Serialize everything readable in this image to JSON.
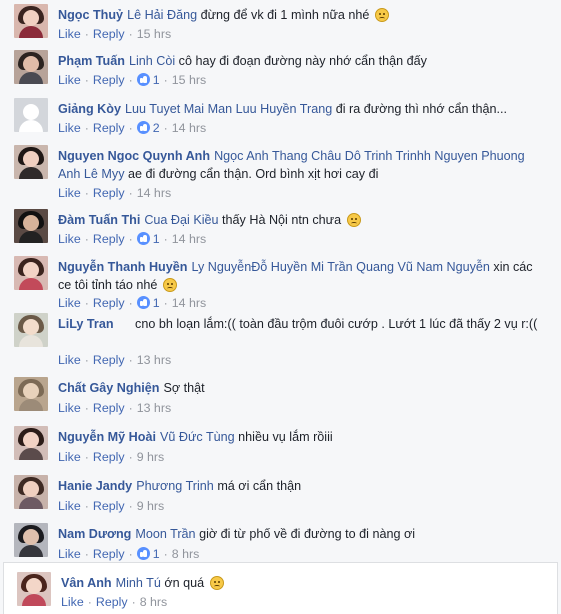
{
  "colors": {
    "link": "#365899",
    "meta": "#90949c",
    "action": "#4267b2",
    "badge": "#5890ff"
  },
  "comments": [
    {
      "author": "Ngọc Thuỷ",
      "tags": "Lê Hải Đăng",
      "message": "đừng để vk đi 1 mình nữa nhé",
      "emoji": "frowning-face-icon",
      "like": "Like",
      "reply": "Reply",
      "likes": "",
      "time": "15 hrs"
    },
    {
      "author": "Phạm Tuấn",
      "tags": "Linh Còi",
      "message": "cô hay đi đoạn đường này nhớ cẩn thận đấy",
      "like": "Like",
      "reply": "Reply",
      "likes": "1",
      "time": "15 hrs"
    },
    {
      "author": "Giảng Kòy",
      "tags": "Luu Tuyet Mai Man Luu Huyền Trang",
      "message": "đi ra đường thì nhớ cẩn thận...",
      "like": "Like",
      "reply": "Reply",
      "likes": "2",
      "time": "14 hrs"
    },
    {
      "author": "Nguyen Ngoc Quynh Anh",
      "tags": "Ngọc Anh Thang Châu Dô Trinh Trinhh Nguyen Phuong Anh Lê Myy",
      "message": "ae đi đường cẩn thận. Ord bình xịt hơi cay đi",
      "like": "Like",
      "reply": "Reply",
      "likes": "",
      "time": "14 hrs"
    },
    {
      "author": "Đàm Tuấn Thi",
      "tags": "Cua Đại Kiều",
      "message": "thấy Hà Nội ntn chưa",
      "emoji": "relieved-face-icon",
      "like": "Like",
      "reply": "Reply",
      "likes": "1",
      "time": "14 hrs"
    },
    {
      "author": "Nguyễn Thanh Huyền",
      "tags": "Ly NguyễnĐỗ Huyền Mi Trần Quang Vũ Nam Nguyễn",
      "message": "xin các ce tôi tỉnh táo nhé",
      "emoji": "relieved-face-icon",
      "like": "Like",
      "reply": "Reply",
      "likes": "1",
      "time": "14 hrs"
    },
    {
      "author": "LiLy Tran",
      "tags": "",
      "message": "cno bh loạn lắm:(( toàn đầu trộm đuôi cướp . Lướt 1 lúc đã thấy 2 vụ r:((",
      "like": "Like",
      "reply": "Reply",
      "likes": "",
      "time": "13 hrs"
    },
    {
      "author": "Chất Gây Nghiện",
      "tags": "",
      "message": "Sợ thật",
      "like": "Like",
      "reply": "Reply",
      "likes": "",
      "time": "13 hrs"
    },
    {
      "author": "Nguyễn Mỹ Hoài",
      "tags": "Vũ Đức Tùng",
      "message": "nhiều vụ lắm rồiii",
      "like": "Like",
      "reply": "Reply",
      "likes": "",
      "time": "9 hrs"
    },
    {
      "author": "Hanie Jandy",
      "tags": "Phương Trinh",
      "message": "má ơi cẩn thận",
      "like": "Like",
      "reply": "Reply",
      "likes": "",
      "time": "9 hrs"
    },
    {
      "author": "Nam Dương",
      "tags": "Moon Trần",
      "message": "giờ đi từ phố về đi đường to đi nàng ơi",
      "like": "Like",
      "reply": "Reply",
      "likes": "1",
      "time": "8 hrs"
    },
    {
      "author": "Vân Anh",
      "tags": "Minh Tú",
      "message": "ớn quá",
      "emoji": "astonished-face-icon",
      "like": "Like",
      "reply": "Reply",
      "likes": "",
      "time": "8 hrs"
    }
  ]
}
